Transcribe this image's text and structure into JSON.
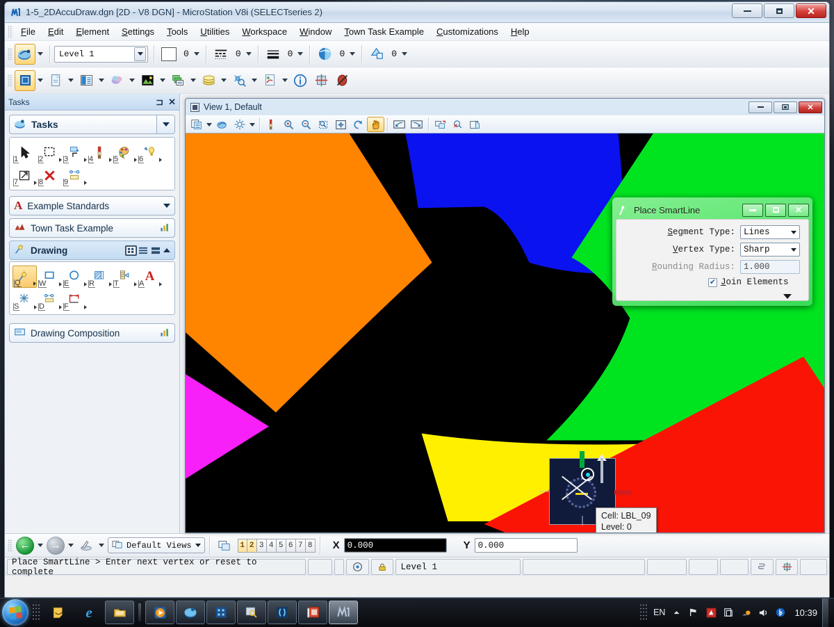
{
  "window": {
    "title": "1-5_2DAccuDraw.dgn [2D - V8 DGN] - MicroStation V8i (SELECTseries 2)",
    "icon": "microstation-icon",
    "minimize_label": "Minimize",
    "restore_label": "Restore",
    "close_label": "Close"
  },
  "menu": {
    "items": [
      {
        "label": "File"
      },
      {
        "label": "Edit"
      },
      {
        "label": "Element"
      },
      {
        "label": "Settings"
      },
      {
        "label": "Tools"
      },
      {
        "label": "Utilities"
      },
      {
        "label": "Workspace"
      },
      {
        "label": "Window"
      },
      {
        "label": "Town Task Example"
      },
      {
        "label": "Customizations"
      },
      {
        "label": "Help"
      }
    ]
  },
  "attributes_toolbar": {
    "active_tool": "element-attributes-icon",
    "level": "Level 1",
    "color_value": "0",
    "linestyle_value": "0",
    "weight_value": "0",
    "transparency_value": "0",
    "priority_value": "0"
  },
  "primary_toolbar": {
    "icons": [
      "models-icon",
      "references-icon",
      "level-manager-icon",
      "level-display-icon",
      "raster-manager-icon",
      "cell-library-icon",
      "element-templates-icon",
      "analyze-element-icon",
      "markup-icon",
      "info-icon",
      "accudraw-icon",
      "no-snap-icon"
    ]
  },
  "tasks_panel": {
    "header": "Tasks",
    "pin_icon": "pin-icon",
    "close_icon": "close-icon",
    "selector_label": "Tasks",
    "main_tools": [
      {
        "key": "1",
        "name": "element-selection-tool"
      },
      {
        "key": "2",
        "name": "fence-tool"
      },
      {
        "key": "3",
        "name": "manipulate-tool"
      },
      {
        "key": "4",
        "name": "change-attributes-tool"
      },
      {
        "key": "5",
        "name": "palette-tool"
      },
      {
        "key": "6",
        "name": "measure-tool"
      },
      {
        "key": "7",
        "name": "modify-tool"
      },
      {
        "key": "8",
        "name": "delete-element-tool"
      },
      {
        "key": "9",
        "name": "dimension-tool"
      }
    ],
    "groups": [
      {
        "label": "Example Standards",
        "icon": "text-a-icon",
        "state": "collapsed"
      },
      {
        "label": "Town Task Example",
        "icon": "town-icon",
        "state": "collapsed"
      },
      {
        "label": "Drawing",
        "icon": "drawing-icon",
        "state": "expanded"
      },
      {
        "label": "Drawing Composition",
        "icon": "composition-icon",
        "state": "collapsed"
      }
    ],
    "drawing_tools": [
      {
        "key": "Q",
        "name": "place-smartline-tool"
      },
      {
        "key": "W",
        "name": "place-block-tool"
      },
      {
        "key": "E",
        "name": "place-circle-tool"
      },
      {
        "key": "R",
        "name": "pattern-area-tool"
      },
      {
        "key": "T",
        "name": "place-cell-tool"
      },
      {
        "key": "A",
        "name": "place-text-tool"
      },
      {
        "key": "S",
        "name": "measure-tool"
      },
      {
        "key": "D",
        "name": "dimension-tool"
      },
      {
        "key": "F",
        "name": "dimension-linear-tool"
      }
    ],
    "view_modes": [
      "grid-view-icon",
      "list-view-icon",
      "wide-list-view-icon"
    ]
  },
  "view_window": {
    "title": "View 1, Default",
    "icon": "view-square-icon",
    "controls": [
      "minimize",
      "restore",
      "close"
    ],
    "toolbar_icons": [
      "view-attributes-icon",
      "view-display-style-icon",
      "view-brightness-icon",
      "update-view-icon",
      "zoom-in-icon",
      "zoom-out-icon",
      "window-area-icon",
      "fit-view-icon",
      "rotate-view-icon",
      "pan-view-icon",
      "view-previous-icon",
      "view-next-icon",
      "copy-view-icon",
      "clip-volume-icon",
      "clip-mask-icon"
    ],
    "active_toolbar_icon": "pan-view-icon"
  },
  "canvas": {
    "background": "#000000",
    "wedges": [
      {
        "name": "wedge-orange",
        "color": "#ff8400"
      },
      {
        "name": "wedge-blue",
        "color": "#0b12f0"
      },
      {
        "name": "wedge-green",
        "color": "#00e420"
      },
      {
        "name": "wedge-magenta",
        "color": "#f820f8"
      },
      {
        "name": "wedge-yellow",
        "color": "#fff000"
      },
      {
        "name": "wedge-red",
        "color": "#fa1405"
      }
    ],
    "tooltip": {
      "line1": "Cell: LBL_09",
      "line2": "Level: 0"
    },
    "accudraw": {
      "x_axis_color": "#d41c1c",
      "y_axis_color": "#00a83c",
      "origin_color": "#22d3f0"
    }
  },
  "smartline_dialog": {
    "title": "Place SmartLine",
    "icon": "smartline-icon",
    "accent_color": "#3cdc5a",
    "fields": [
      {
        "label": "Segment Type:",
        "value": "Lines",
        "type": "combo",
        "disabled": false
      },
      {
        "label": "Vertex Type:",
        "value": "Sharp",
        "type": "combo",
        "disabled": false
      },
      {
        "label": "Rounding Radius:",
        "value": "1.000",
        "type": "text",
        "disabled": true
      }
    ],
    "checkbox": {
      "label": "Join Elements",
      "checked": true,
      "mark": "✔"
    },
    "expand_icon": "chevron-down-icon",
    "minimize_label": "Minimize",
    "restore_label": "Restore",
    "close_label": "Close"
  },
  "view_groups_bar": {
    "back_icon": "back-arrow-icon",
    "forward_icon": "forward-arrow-icon",
    "previous_icon": "view-previous-group-icon",
    "group_name": "Default Views",
    "window_icon": "view-window-icon",
    "view_numbers": [
      {
        "n": "1",
        "on": true
      },
      {
        "n": "2",
        "on": true
      },
      {
        "n": "3",
        "on": false
      },
      {
        "n": "4",
        "on": false
      },
      {
        "n": "5",
        "on": false
      },
      {
        "n": "6",
        "on": false
      },
      {
        "n": "7",
        "on": false
      },
      {
        "n": "8",
        "on": false
      }
    ],
    "x_label": "X",
    "x_value": "0.000",
    "y_label": "Y",
    "y_value": "0.000"
  },
  "statusbar": {
    "message": "Place SmartLine > Enter next vertex or reset to complete",
    "snap_icon": "snap-mode-icon",
    "lock_icon": "locks-icon",
    "level": "Level 1",
    "model_icon": "model-icon",
    "accudraw_icon": "accudraw-status-icon"
  },
  "taskbar": {
    "start_label": "Start",
    "apps": [
      {
        "name": "taskbar-app-notes",
        "glyph": "◔",
        "color": "#f0c040",
        "state": "pinned"
      },
      {
        "name": "taskbar-app-internet-explorer",
        "glyph": "e",
        "color": "#2e9fe0",
        "state": "pinned"
      },
      {
        "name": "taskbar-app-explorer",
        "glyph": "▤",
        "color": "#f5c35a",
        "state": "running"
      },
      {
        "name": "taskbar-app-media-player",
        "glyph": "▶",
        "color": "#ff9a2e",
        "state": "running"
      },
      {
        "name": "taskbar-app-bentley",
        "glyph": "●",
        "color": "#3bb4e8",
        "state": "running"
      },
      {
        "name": "taskbar-app-blue-tool",
        "glyph": "░",
        "color": "#5ab4f0",
        "state": "running"
      },
      {
        "name": "taskbar-app-search",
        "glyph": "⚲",
        "color": "#bcd6ef",
        "state": "running"
      },
      {
        "name": "taskbar-app-brackets",
        "glyph": "()",
        "color": "#6fc0f5",
        "state": "running"
      },
      {
        "name": "taskbar-app-screenshot",
        "glyph": "▣",
        "color": "#e8593c",
        "state": "running"
      },
      {
        "name": "taskbar-app-microstation",
        "glyph": "Μ",
        "color": "#9ab6d6",
        "state": "active"
      }
    ],
    "tray": {
      "language": "EN",
      "show_hidden_icon": "chevron-up-icon",
      "flag_icon": "action-center-icon",
      "red_icon": "input-method-icon",
      "copy_icon": "clipboard-icon",
      "update_icon": "update-icon",
      "volume_icon": "volume-icon",
      "bluetooth_icon": "bluetooth-icon",
      "clock": "10:39"
    }
  }
}
